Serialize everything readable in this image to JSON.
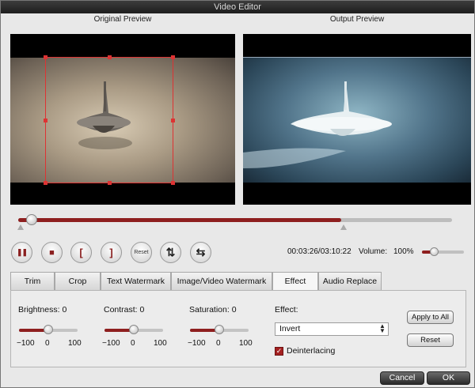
{
  "window": {
    "title": "Video Editor"
  },
  "previews": {
    "original_label": "Original Preview",
    "output_label": "Output Preview"
  },
  "playback": {
    "progress": 0.745,
    "time": "00:03:26/03:10:22",
    "volume_label": "Volume:",
    "volume_value": "100%",
    "volume_level": 0.25,
    "controls": [
      {
        "name": "pause-button",
        "icon": "pause-icon",
        "glyph": "❚❚"
      },
      {
        "name": "stop-button",
        "icon": "stop-icon",
        "glyph": "■"
      },
      {
        "name": "mark-in-button",
        "icon": "bracket-left-icon",
        "glyph": "["
      },
      {
        "name": "mark-out-button",
        "icon": "bracket-right-icon",
        "glyph": "]"
      },
      {
        "name": "reset-button",
        "icon": "reset-icon",
        "glyph": "Reset"
      },
      {
        "name": "flip-vertical-button",
        "icon": "flip-vertical-icon",
        "glyph": "⇅"
      },
      {
        "name": "flip-horizontal-button",
        "icon": "flip-horizontal-icon",
        "glyph": "⇆"
      }
    ]
  },
  "tabs": [
    {
      "label": "Trim"
    },
    {
      "label": "Crop"
    },
    {
      "label": "Text Watermark"
    },
    {
      "label": "Image/Video Watermark"
    },
    {
      "label": "Effect"
    },
    {
      "label": "Audio Replace"
    }
  ],
  "active_tab": "Effect",
  "effect_panel": {
    "brightness": {
      "label": "Brightness:",
      "value": "0",
      "level": 0.5
    },
    "contrast": {
      "label": "Contrast:",
      "value": "0",
      "level": 0.5
    },
    "saturation": {
      "label": "Saturation:",
      "value": "0",
      "level": 0.5
    },
    "scale": {
      "min": "−100",
      "mid": "0",
      "max": "100"
    },
    "effect_label": "Effect:",
    "effect_value": "Invert",
    "deinterlacing_label": "Deinterlacing",
    "deinterlacing_checked": true,
    "apply_all_label": "Apply to All",
    "reset_label": "Reset"
  },
  "footer": {
    "cancel_label": "Cancel",
    "ok_label": "OK"
  },
  "colors": {
    "accent": "#8e1f1f",
    "crop_border": "#dd3333"
  }
}
